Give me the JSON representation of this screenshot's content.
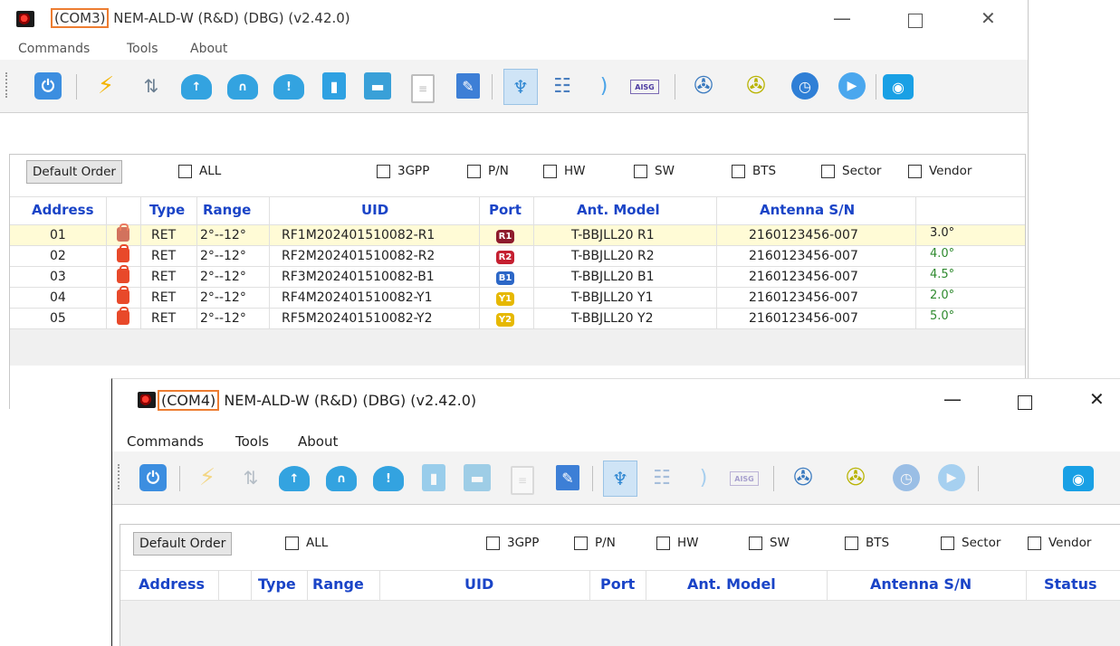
{
  "window1": {
    "title_port": "(COM3)",
    "title_rest": " NEM-ALD-W (R&D) (DBG) (v2.42.0)",
    "controls": {
      "minimize": "—",
      "maximize": "",
      "close": "✕"
    },
    "menu": [
      "Commands",
      "Tools",
      "About"
    ],
    "toolbar_icons": [
      "power-icon",
      "lightning-icon",
      "swap-icon",
      "cloud-upload-icon",
      "cloud-icon",
      "cloud-warning-icon",
      "trash-icon",
      "save-icon",
      "document-icon",
      "edit-icon",
      "antenna-icon",
      "tree-icon",
      "wave-icon",
      "aisg-icon",
      "satellite-icon",
      "satellite-scan-icon",
      "timer-icon",
      "play-icon",
      "camera-icon"
    ],
    "filter": {
      "default_order": "Default Order",
      "all": "ALL",
      "options": [
        "3GPP",
        "P/N",
        "HW",
        "SW",
        "BTS",
        "Sector",
        "Vendor"
      ]
    },
    "columns": [
      "Address",
      "Type",
      "Range",
      "UID",
      "Port",
      "Ant. Model",
      "Antenna S/N"
    ],
    "rows": [
      {
        "address": "01",
        "type": "RET",
        "range": "2°--12°",
        "uid": "RF1M202401510082-R1",
        "port": "R1",
        "port_color": "#8e1b2c",
        "model": "T-BBJLL20 R1",
        "sn": "2160123456-007",
        "tilt": "3.0°",
        "tilt_color": "#222222"
      },
      {
        "address": "02",
        "type": "RET",
        "range": "2°--12°",
        "uid": "RF2M202401510082-R2",
        "port": "R2",
        "port_color": "#c51f30",
        "model": "T-BBJLL20 R2",
        "sn": "2160123456-007",
        "tilt": "4.0°",
        "tilt_color": "#2f8a2f"
      },
      {
        "address": "03",
        "type": "RET",
        "range": "2°--12°",
        "uid": "RF3M202401510082-B1",
        "port": "B1",
        "port_color": "#2c67c7",
        "model": "T-BBJLL20 B1",
        "sn": "2160123456-007",
        "tilt": "4.5°",
        "tilt_color": "#2f8a2f"
      },
      {
        "address": "04",
        "type": "RET",
        "range": "2°--12°",
        "uid": "RF4M202401510082-Y1",
        "port": "Y1",
        "port_color": "#e6b800",
        "model": "T-BBJLL20 Y1",
        "sn": "2160123456-007",
        "tilt": "2.0°",
        "tilt_color": "#2f8a2f"
      },
      {
        "address": "05",
        "type": "RET",
        "range": "2°--12°",
        "uid": "RF5M202401510082-Y2",
        "port": "Y2",
        "port_color": "#e6b800",
        "model": "T-BBJLL20 Y2",
        "sn": "2160123456-007",
        "tilt": "5.0°",
        "tilt_color": "#2f8a2f"
      }
    ]
  },
  "window2": {
    "title_port": "(COM4)",
    "title_rest": " NEM-ALD-W (R&D) (DBG) (v2.42.0)",
    "controls": {
      "minimize": "—",
      "maximize": "",
      "close": "✕"
    },
    "menu": [
      "Commands",
      "Tools",
      "About"
    ],
    "filter": {
      "default_order": "Default Order",
      "all": "ALL",
      "options": [
        "3GPP",
        "P/N",
        "HW",
        "SW",
        "BTS",
        "Sector",
        "Vendor"
      ]
    },
    "columns": [
      "Address",
      "Type",
      "Range",
      "UID",
      "Port",
      "Ant. Model",
      "Antenna S/N",
      "Status"
    ]
  }
}
